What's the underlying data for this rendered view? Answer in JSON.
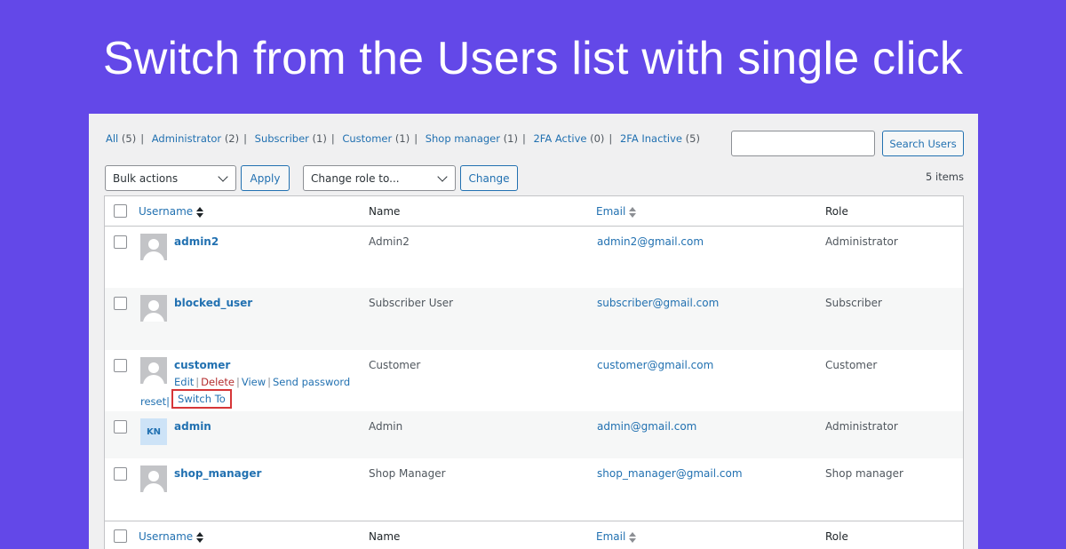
{
  "headline": "Switch from the Users list with single click",
  "filters": [
    {
      "label": "All",
      "count": "(5)"
    },
    {
      "label": "Administrator",
      "count": "(2)"
    },
    {
      "label": "Subscriber",
      "count": "(1)"
    },
    {
      "label": "Customer",
      "count": "(1)"
    },
    {
      "label": "Shop manager",
      "count": "(1)"
    },
    {
      "label": "2FA Active",
      "count": "(0)"
    },
    {
      "label": "2FA Inactive",
      "count": "(5)"
    }
  ],
  "separator": "|",
  "search": {
    "value": "",
    "button": "Search Users"
  },
  "toolbar": {
    "bulk_actions": "Bulk actions",
    "apply": "Apply",
    "change_role": "Change role to...",
    "change": "Change",
    "items_count": "5 items"
  },
  "columns": {
    "username": "Username",
    "name": "Name",
    "email": "Email",
    "role": "Role"
  },
  "rows": [
    {
      "username": "admin2",
      "name": "Admin2",
      "email": "admin2@gmail.com",
      "role": "Administrator"
    },
    {
      "username": "blocked_user",
      "name": "Subscriber User",
      "email": "subscriber@gmail.com",
      "role": "Subscriber"
    },
    {
      "username": "customer",
      "name": "Customer",
      "email": "customer@gmail.com",
      "role": "Customer"
    },
    {
      "username": "admin",
      "name": "Admin",
      "email": "admin@gmail.com",
      "role": "Administrator",
      "avatar_initials": "KN"
    },
    {
      "username": "shop_manager",
      "name": "Shop Manager",
      "email": "shop_manager@gmail.com",
      "role": "Shop manager"
    }
  ],
  "row_actions": {
    "edit": "Edit",
    "delete": "Delete",
    "view": "View",
    "send_password": "Send password",
    "reset": "reset",
    "switch_to": "Switch To"
  },
  "colors": {
    "background": "#6348e8",
    "link": "#2271b1",
    "delete": "#b32d2e",
    "highlight": "#d63638"
  }
}
